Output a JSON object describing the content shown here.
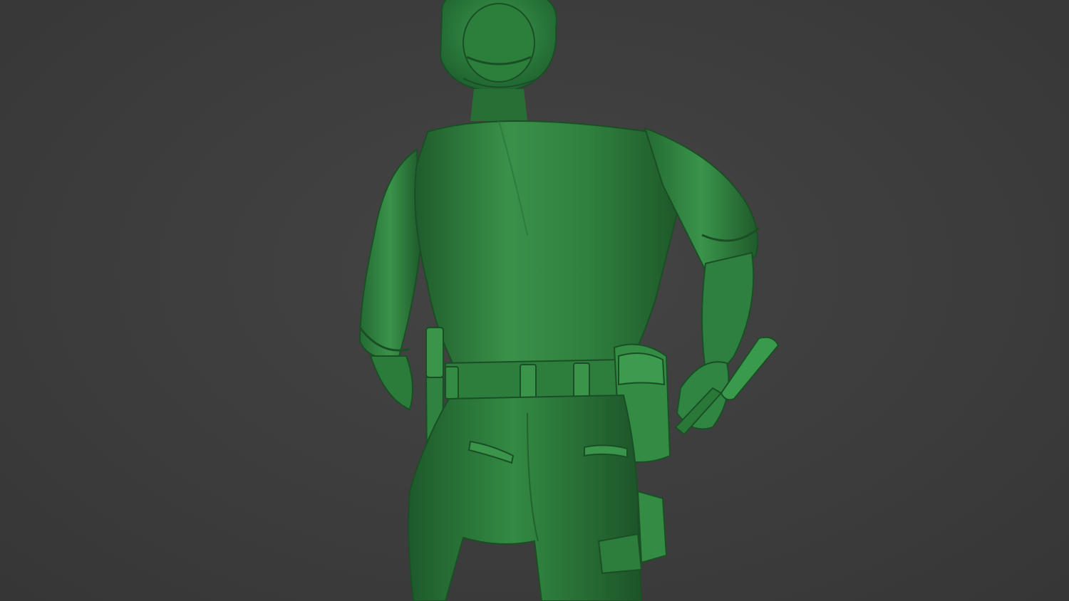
{
  "scene": {
    "background_color": "#3d3d3d",
    "model_color": "#2e7d3e",
    "model_highlight": "#4aa35a",
    "model_shadow": "#1d5a2a",
    "subject": "toy-soldier-figure-back-view"
  }
}
